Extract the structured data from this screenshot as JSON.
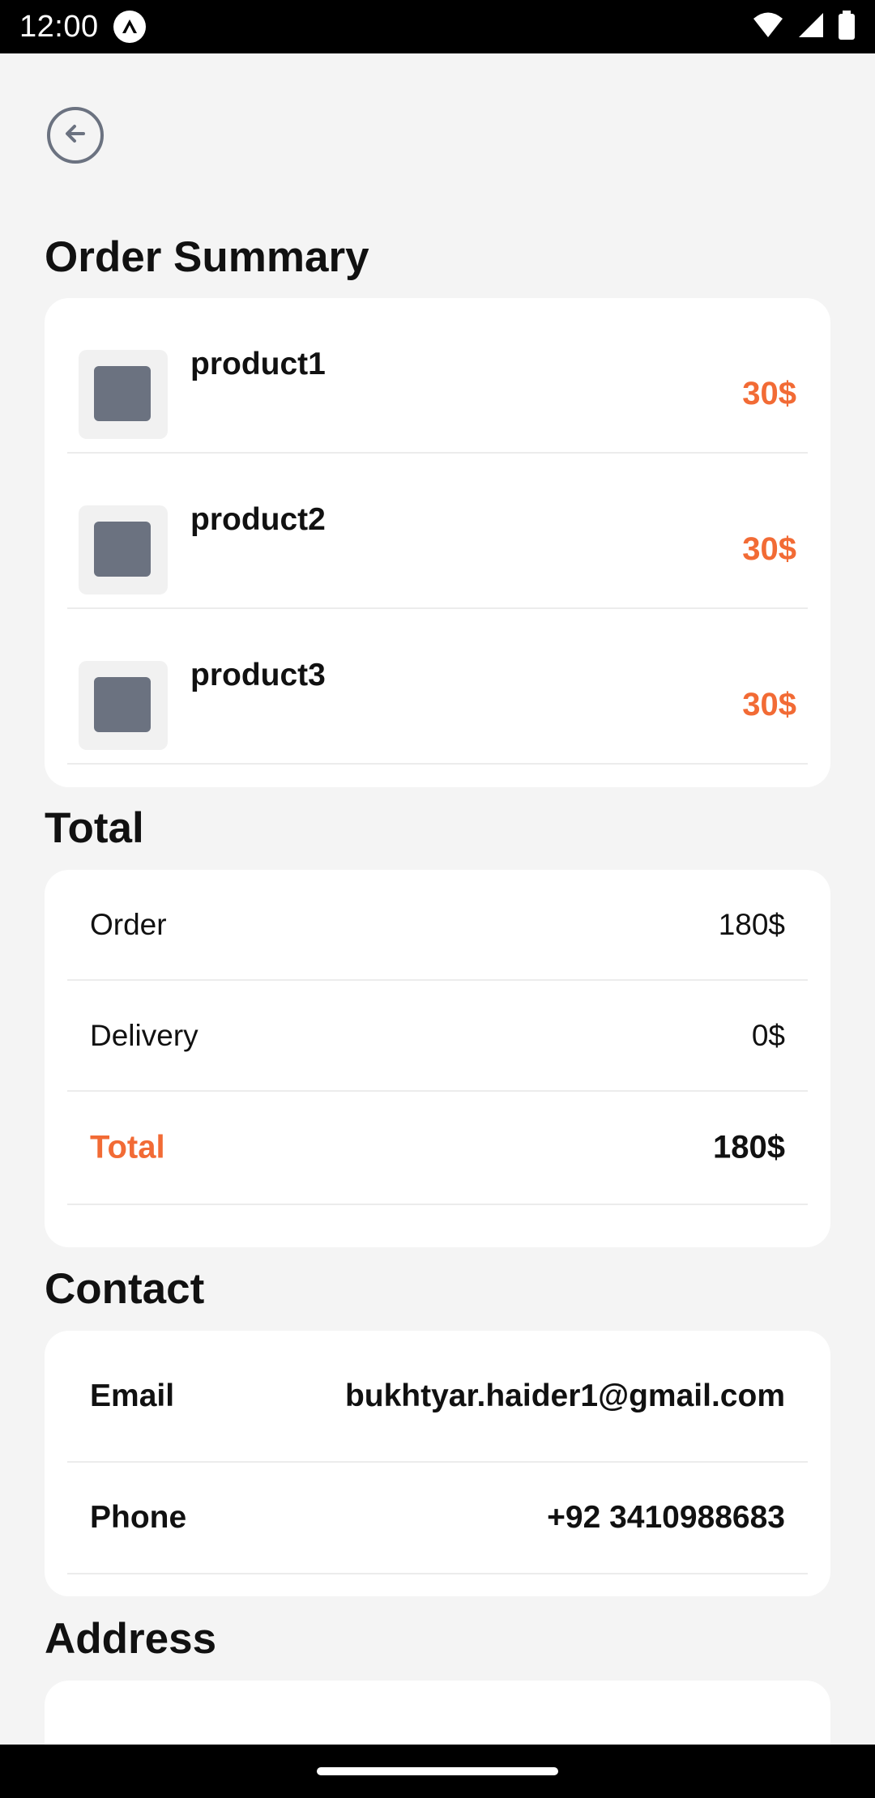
{
  "status_bar": {
    "time": "12:00"
  },
  "header": {
    "back_icon": "arrow-left-circle-icon"
  },
  "order_summary": {
    "title": "Order Summary",
    "items": [
      {
        "name": "product1",
        "price": "30$"
      },
      {
        "name": "product2",
        "price": "30$"
      },
      {
        "name": "product3",
        "price": "30$"
      }
    ]
  },
  "total": {
    "title": "Total",
    "order_label": "Order",
    "order_value": "180$",
    "delivery_label": "Delivery",
    "delivery_value": "0$",
    "total_label": "Total",
    "total_value": "180$"
  },
  "contact": {
    "title": "Contact",
    "email_label": "Email",
    "email_value": "bukhtyar.haider1@gmail.com",
    "phone_label": "Phone",
    "phone_value": "+92 3410988683"
  },
  "address": {
    "title": "Address"
  },
  "colors": {
    "accent": "#f26b35",
    "thumb": "#6b7280",
    "background": "#f4f4f4"
  }
}
